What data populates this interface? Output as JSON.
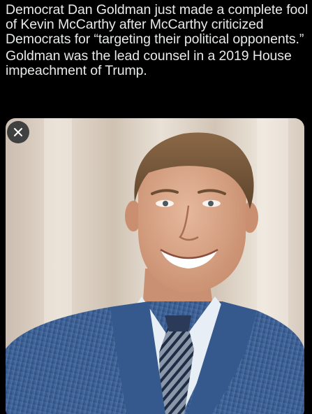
{
  "post": {
    "paragraphs": [
      "Democrat Dan Goldman just made a complete fool of Kevin McCarthy after McCarthy criticized Democrats for “targeting their political opponents.”",
      "Goldman was the lead counsel in a 2019 House impeachment of Trump."
    ]
  },
  "media": {
    "close_icon": "close-icon",
    "colors": {
      "background_warm": "#d9cdbf",
      "suit_blue": "#3a5f95",
      "shirt": "#e8eef6",
      "skin": "#d9a78a",
      "hair": "#7a5a3c"
    }
  }
}
